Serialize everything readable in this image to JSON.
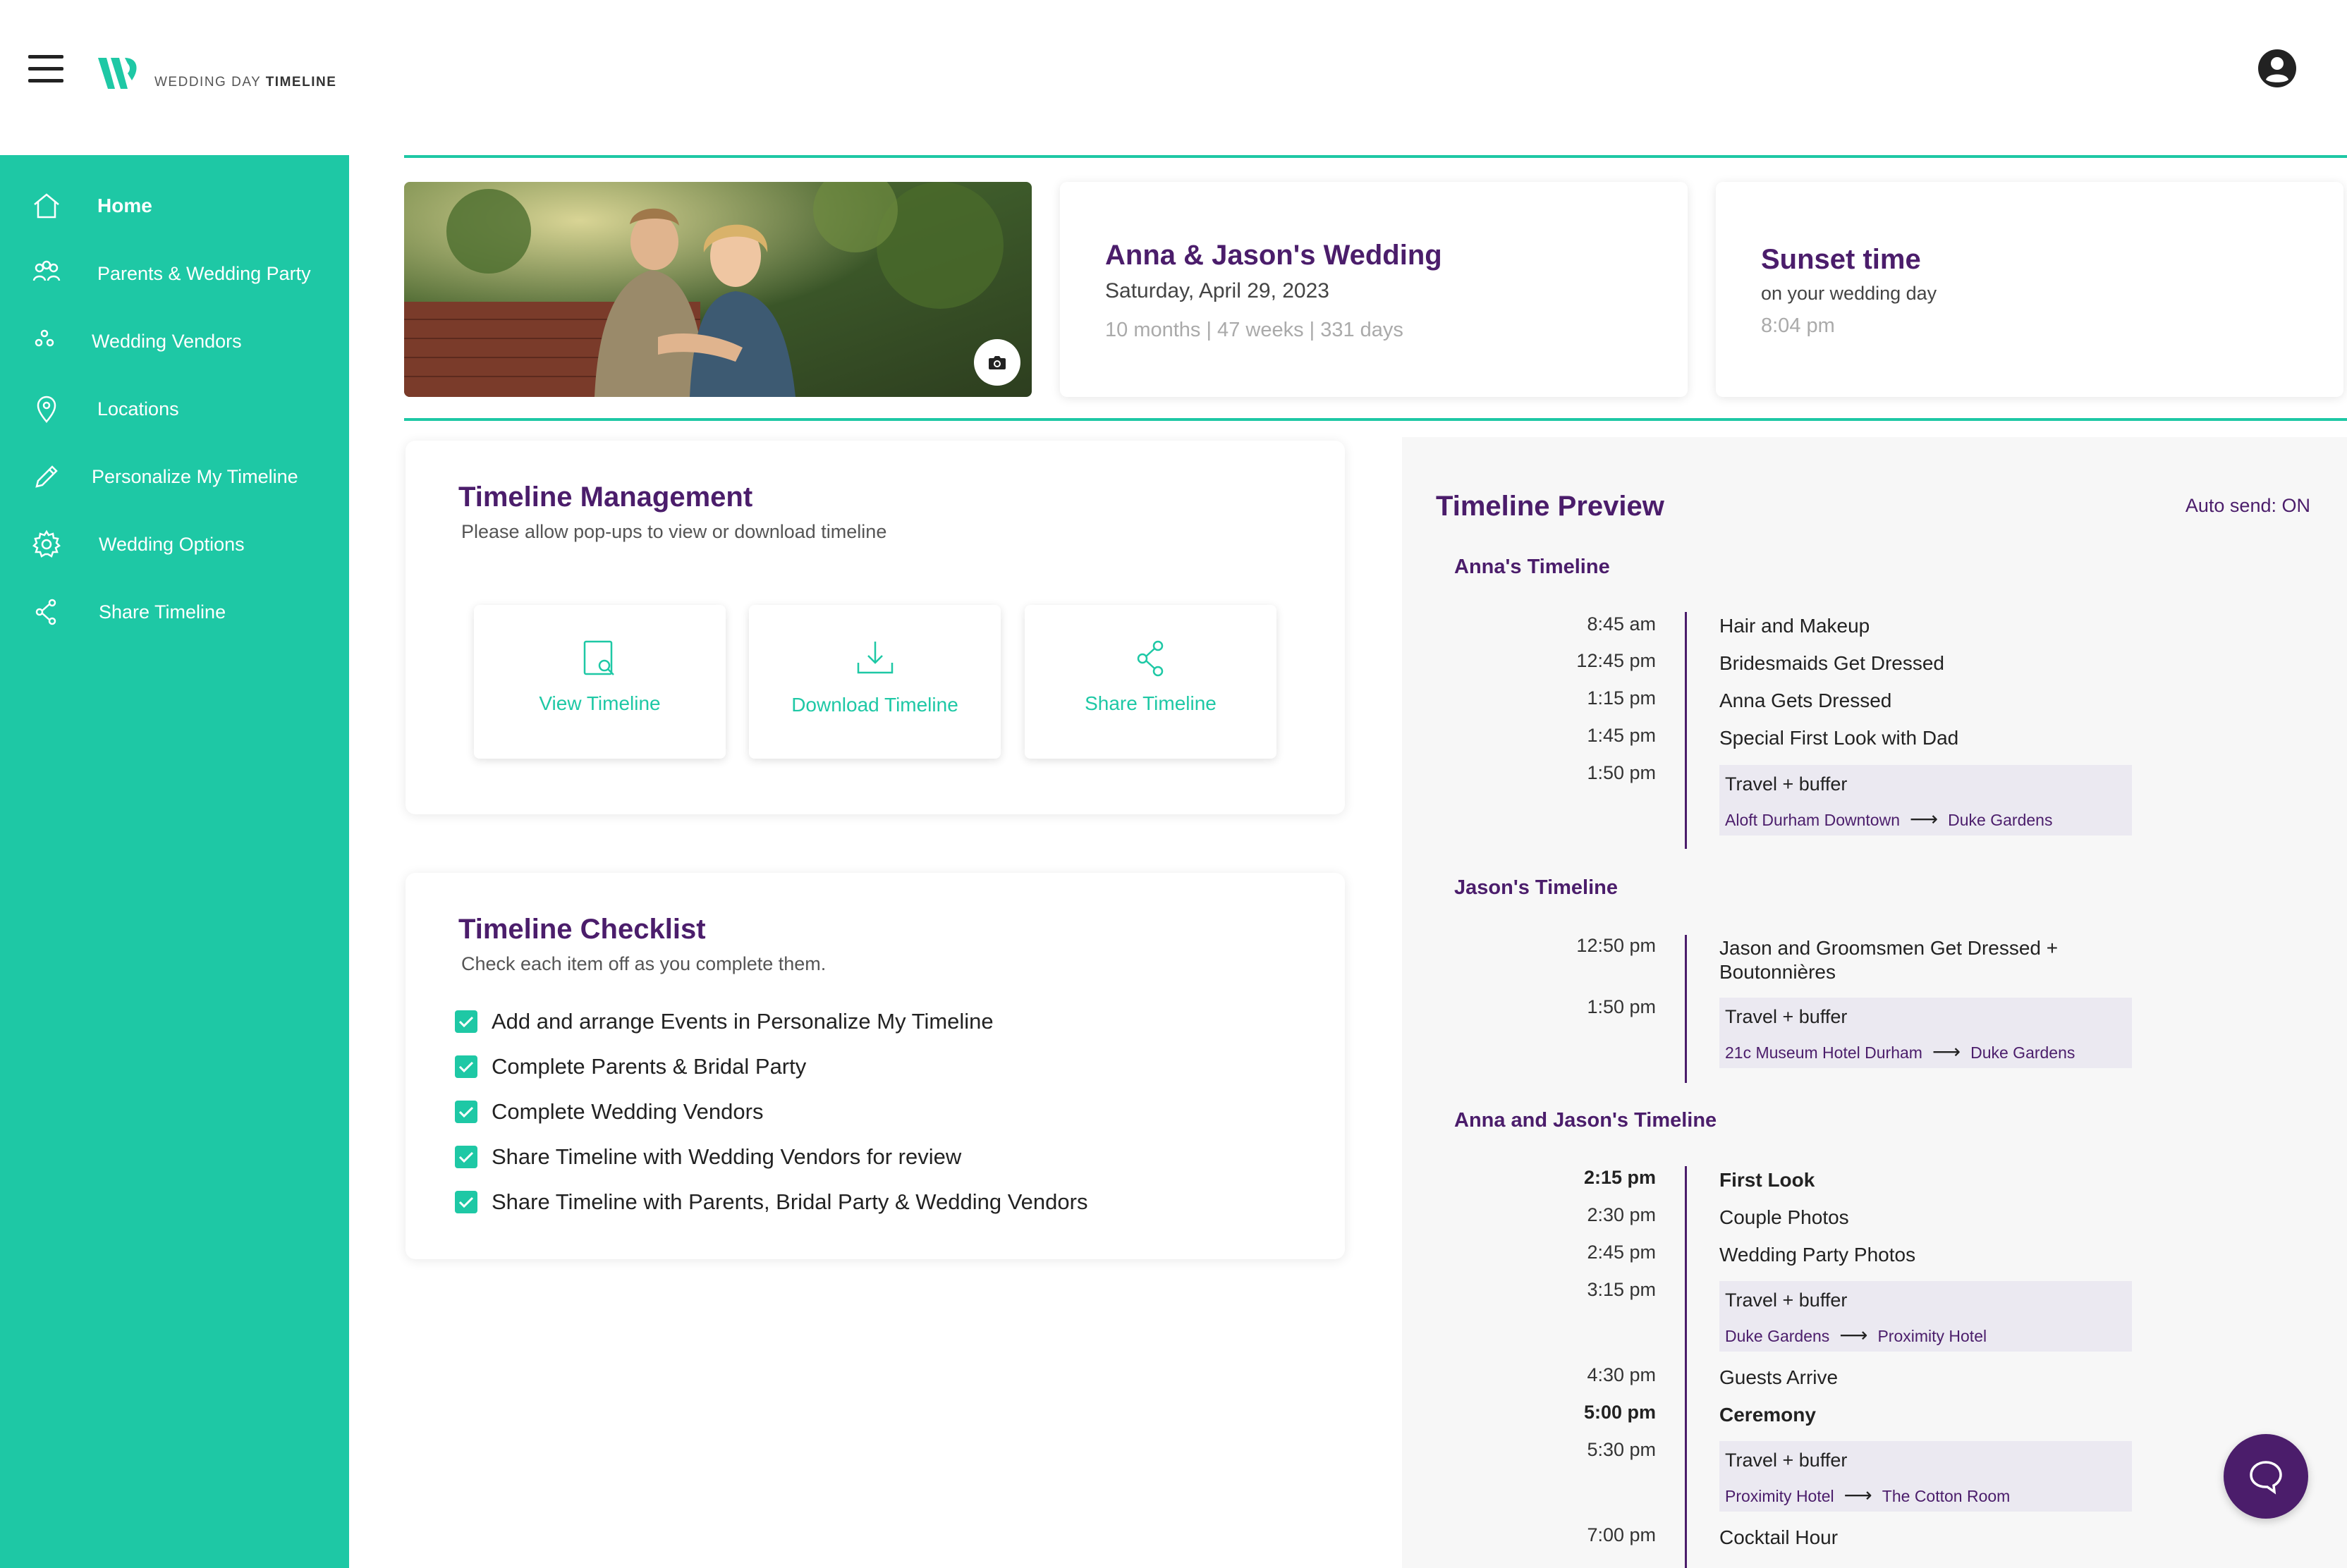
{
  "header": {
    "logo_text_light": "WEDDING DAY ",
    "logo_text_bold": "TIMELINE"
  },
  "sidebar": {
    "items": [
      {
        "label": "Home",
        "icon": "home-icon"
      },
      {
        "label": "Parents & Wedding Party",
        "icon": "people-icon"
      },
      {
        "label": "Wedding Vendors",
        "icon": "vendors-icon"
      },
      {
        "label": "Locations",
        "icon": "location-pin-icon"
      },
      {
        "label": "Personalize My Timeline",
        "icon": "pencil-icon"
      },
      {
        "label": "Wedding Options",
        "icon": "gear-icon"
      },
      {
        "label": "Share Timeline",
        "icon": "share-icon"
      }
    ]
  },
  "wedding_card": {
    "title": "Anna & Jason's Wedding",
    "date": "Saturday, April 29, 2023",
    "countdown": "10 months | 47 weeks | 331 days"
  },
  "sunset_card": {
    "title": "Sunset time",
    "subtitle": "on your wedding day",
    "time": "8:04 pm"
  },
  "management": {
    "title": "Timeline Management",
    "subtitle": "Please allow pop-ups to view or download timeline",
    "buttons": [
      {
        "label": "View Timeline",
        "icon": "view-document-icon"
      },
      {
        "label": "Download Timeline",
        "icon": "download-icon"
      },
      {
        "label": "Share Timeline",
        "icon": "share-icon"
      }
    ]
  },
  "checklist": {
    "title": "Timeline Checklist",
    "subtitle": "Check each item off as you complete them.",
    "items": [
      "Add and arrange Events in Personalize My Timeline",
      "Complete Parents & Bridal Party",
      "Complete Wedding Vendors",
      "Share Timeline with Wedding Vendors for review",
      "Share Timeline with Parents, Bridal Party & Wedding Vendors"
    ]
  },
  "preview": {
    "title": "Timeline Preview",
    "auto_send": "Auto send: ON",
    "annas_heading": "Anna's Timeline",
    "annas_events": [
      {
        "time": "8:45 am",
        "event": "Hair and Makeup"
      },
      {
        "time": "12:45 pm",
        "event": "Bridesmaids Get Dressed"
      },
      {
        "time": "1:15 pm",
        "event": "Anna Gets Dressed"
      },
      {
        "time": "1:45 pm",
        "event": "Special First Look with Dad"
      },
      {
        "time": "1:50 pm"
      }
    ],
    "annas_travel": {
      "title": "Travel + buffer",
      "from": "Aloft Durham Downtown",
      "to": "Duke Gardens"
    },
    "jasons_heading": "Jason's Timeline",
    "jasons_events": [
      {
        "time": "12:50 pm",
        "event_line1": "Jason and Groomsmen Get Dressed +",
        "event_line2": "Boutonnières"
      },
      {
        "time": "1:50 pm"
      }
    ],
    "jasons_travel": {
      "title": "Travel + buffer",
      "from": "21c Museum Hotel Durham",
      "to": "Duke Gardens"
    },
    "joint_heading": "Anna and Jason's Timeline",
    "joint_events": [
      {
        "time": "2:15 pm",
        "event": "First Look"
      },
      {
        "time": "2:30 pm",
        "event": "Couple Photos"
      },
      {
        "time": "2:45 pm",
        "event": "Wedding Party Photos"
      },
      {
        "time": "3:15 pm"
      },
      {
        "time": "4:30 pm",
        "event": "Guests Arrive"
      },
      {
        "time": "5:00 pm",
        "event": "Ceremony"
      },
      {
        "time": "5:30 pm"
      },
      {
        "time": "7:00 pm",
        "event": "Cocktail Hour"
      }
    ],
    "joint_travel_1": {
      "title": "Travel + buffer",
      "from": "Duke Gardens",
      "to": "Proximity Hotel"
    },
    "joint_travel_2": {
      "title": "Travel + buffer",
      "from": "Proximity Hotel",
      "to": "The Cotton Room"
    }
  },
  "colors": {
    "teal": "#1ec8a5",
    "purple": "#4b1d6b"
  }
}
